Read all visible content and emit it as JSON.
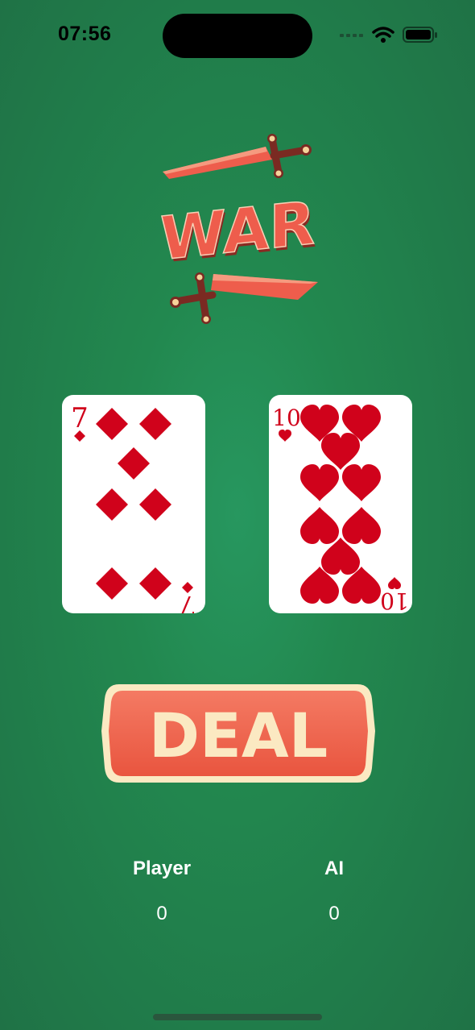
{
  "status_bar": {
    "time": "07:56",
    "icons": [
      "cellular-signal-icon",
      "wifi-icon",
      "battery-icon"
    ]
  },
  "logo": {
    "text": "WAR",
    "icon": "crossed-swords-icon"
  },
  "cards": {
    "player": {
      "rank": "7",
      "suit": "diamonds",
      "suit_symbol": "♦",
      "color": "#d0021b"
    },
    "ai": {
      "rank": "10",
      "suit": "hearts",
      "suit_symbol": "♥",
      "color": "#d0021b"
    }
  },
  "deal_button": {
    "label": "DEAL",
    "fill": "#ef6350",
    "border": "#fbe9c2",
    "text_color": "#fbe9c2"
  },
  "scores": {
    "player": {
      "label": "Player",
      "value": "0"
    },
    "ai": {
      "label": "AI",
      "value": "0"
    }
  },
  "colors": {
    "felt": "#22884f",
    "logo_red": "#ee5d4c"
  }
}
